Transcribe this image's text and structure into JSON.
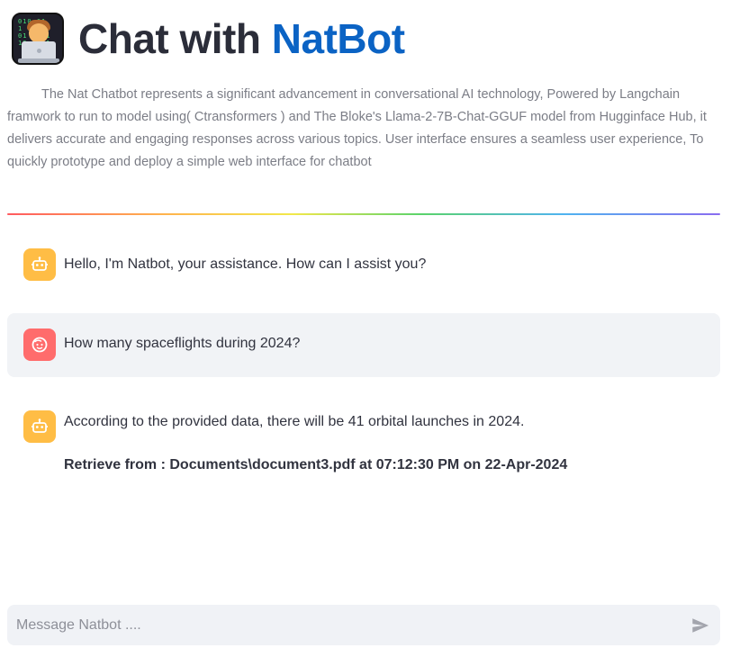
{
  "header": {
    "title_prefix": "Chat with ",
    "title_accent": "NatBot",
    "logo_icon": "technologist-icon"
  },
  "description": "The Nat Chatbot represents a significant advancement in conversational AI technology, Powered by Langchain framwork to run to model using( Ctransformers ) and The Bloke's Llama-2-7B-Chat-GGUF model from Hugginface Hub, it delivers accurate and engaging responses across various topics. User interface ensures a seamless user experience, To quickly prototype and deploy a simple web interface for chatbot",
  "messages": [
    {
      "role": "assistant",
      "avatar_icon": "bot-icon",
      "text": "Hello, I'm Natbot, your assistance. How can I assist you?"
    },
    {
      "role": "user",
      "avatar_icon": "user-face-icon",
      "text": "How many spaceflights during 2024?"
    },
    {
      "role": "assistant",
      "avatar_icon": "bot-icon",
      "text": "According to the provided data, there will be 41 orbital launches in 2024.",
      "source": "Retrieve from : Documents\\document3.pdf at 07:12:30 PM on 22-Apr-2024"
    }
  ],
  "input": {
    "placeholder": "Message Natbot ....",
    "value": "",
    "send_icon": "send-icon"
  },
  "colors": {
    "title_accent": "#0b63c4",
    "bot_avatar": "#ffbd45",
    "user_avatar": "#ff6c6c",
    "user_message_bg": "#f1f3f6"
  }
}
